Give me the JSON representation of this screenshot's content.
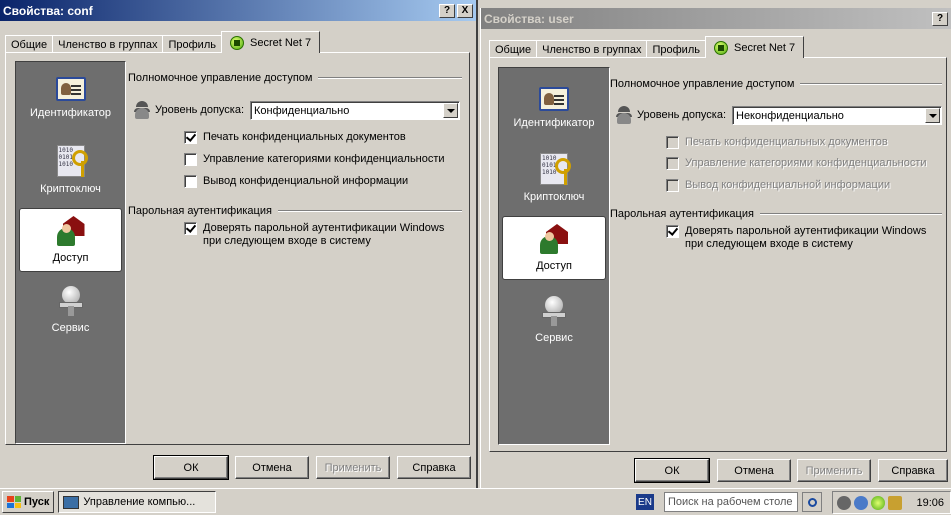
{
  "dialogs": [
    {
      "title": "Свойства: conf",
      "tabs": [
        "Общие",
        "Членство в группах",
        "Профиль",
        "Secret Net 7"
      ],
      "sidebar": [
        "Идентификатор",
        "Криптоключ",
        "Доступ",
        "Сервис"
      ],
      "access_group_title": "Полномочное управление доступом",
      "level_label": "Уровень допуска:",
      "level_value": "Конфиденциально",
      "checkboxes": [
        {
          "label": "Печать конфиденциальных документов",
          "checked": true,
          "disabled": false
        },
        {
          "label": "Управление категориями конфиденциальности",
          "checked": false,
          "disabled": false
        },
        {
          "label": "Вывод конфиденциальной информации",
          "checked": false,
          "disabled": false
        }
      ],
      "auth_group_title": "Парольная аутентификация",
      "auth_checkbox": {
        "line1": "Доверять парольной аутентификации Windows",
        "line2": "при следующем входе в систему",
        "checked": true
      },
      "buttons": {
        "ok": "ОК",
        "cancel": "Отмена",
        "apply": "Применить",
        "help": "Справка"
      }
    },
    {
      "title": "Свойства: user",
      "tabs": [
        "Общие",
        "Членство в группах",
        "Профиль",
        "Secret Net 7"
      ],
      "sidebar": [
        "Идентификатор",
        "Криптоключ",
        "Доступ",
        "Сервис"
      ],
      "access_group_title": "Полномочное управление доступом",
      "level_label": "Уровень допуска:",
      "level_value": "Неконфиденциально",
      "checkboxes": [
        {
          "label": "Печать конфиденциальных документов",
          "checked": false,
          "disabled": true
        },
        {
          "label": "Управление категориями конфиденциальности",
          "checked": false,
          "disabled": true
        },
        {
          "label": "Вывод конфиденциальной информации",
          "checked": false,
          "disabled": true
        }
      ],
      "auth_group_title": "Парольная аутентификация",
      "auth_checkbox": {
        "line1": "Доверять парольной аутентификации Windows",
        "line2": "при следующем входе в систему",
        "checked": true
      },
      "buttons": {
        "ok": "ОК",
        "cancel": "Отмена",
        "apply": "Применить",
        "help": "Справка"
      }
    }
  ],
  "title_buttons": {
    "help": "?",
    "close": "X"
  },
  "taskbar": {
    "start_label": "Пуск",
    "task_label": "Управление компью...",
    "lang": "EN",
    "search_placeholder": "Поиск на рабочем столе",
    "clock": "19:06"
  },
  "colors": {
    "active_title": "#0a246a",
    "inactive_title": "#808080",
    "face": "#d4d0c8",
    "sidebar": "#6e6e6e"
  }
}
